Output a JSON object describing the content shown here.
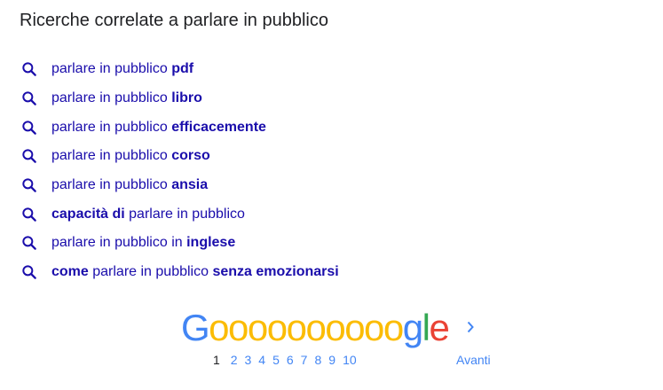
{
  "heading": "Ricerche correlate a parlare in pubblico",
  "related_searches": [
    {
      "icon": "search-icon",
      "parts": [
        {
          "t": "parlare in pubblico ",
          "b": false
        },
        {
          "t": "pdf",
          "b": true
        }
      ]
    },
    {
      "icon": "search-icon",
      "parts": [
        {
          "t": "parlare in pubblico ",
          "b": false
        },
        {
          "t": "libro",
          "b": true
        }
      ]
    },
    {
      "icon": "search-icon",
      "parts": [
        {
          "t": "parlare in pubblico ",
          "b": false
        },
        {
          "t": "efficacemente",
          "b": true
        }
      ]
    },
    {
      "icon": "search-icon",
      "parts": [
        {
          "t": "parlare in pubblico ",
          "b": false
        },
        {
          "t": "corso",
          "b": true
        }
      ]
    },
    {
      "icon": "search-icon",
      "parts": [
        {
          "t": "parlare in pubblico ",
          "b": false
        },
        {
          "t": "ansia",
          "b": true
        }
      ]
    },
    {
      "icon": "search-icon",
      "parts": [
        {
          "t": "capacità di",
          "b": true
        },
        {
          "t": " parlare in pubblico",
          "b": false
        }
      ]
    },
    {
      "icon": "search-icon",
      "parts": [
        {
          "t": "parlare in pubblico in ",
          "b": false
        },
        {
          "t": "inglese",
          "b": true
        }
      ]
    },
    {
      "icon": "search-icon",
      "parts": [
        {
          "t": "come",
          "b": true
        },
        {
          "t": " parlare in pubblico ",
          "b": false
        },
        {
          "t": "senza emozionarsi",
          "b": true
        }
      ]
    }
  ],
  "pagination": {
    "logo_text": "Goooooooooogle",
    "current_page": "1",
    "pages": [
      "2",
      "3",
      "4",
      "5",
      "6",
      "7",
      "8",
      "9",
      "10"
    ],
    "next_label": "Avanti",
    "next_icon": "chevron-right-icon"
  },
  "colors": {
    "link": "#1a0dab",
    "pager_link": "#4285f4",
    "text": "#202124",
    "icon": "#1a0dab"
  }
}
